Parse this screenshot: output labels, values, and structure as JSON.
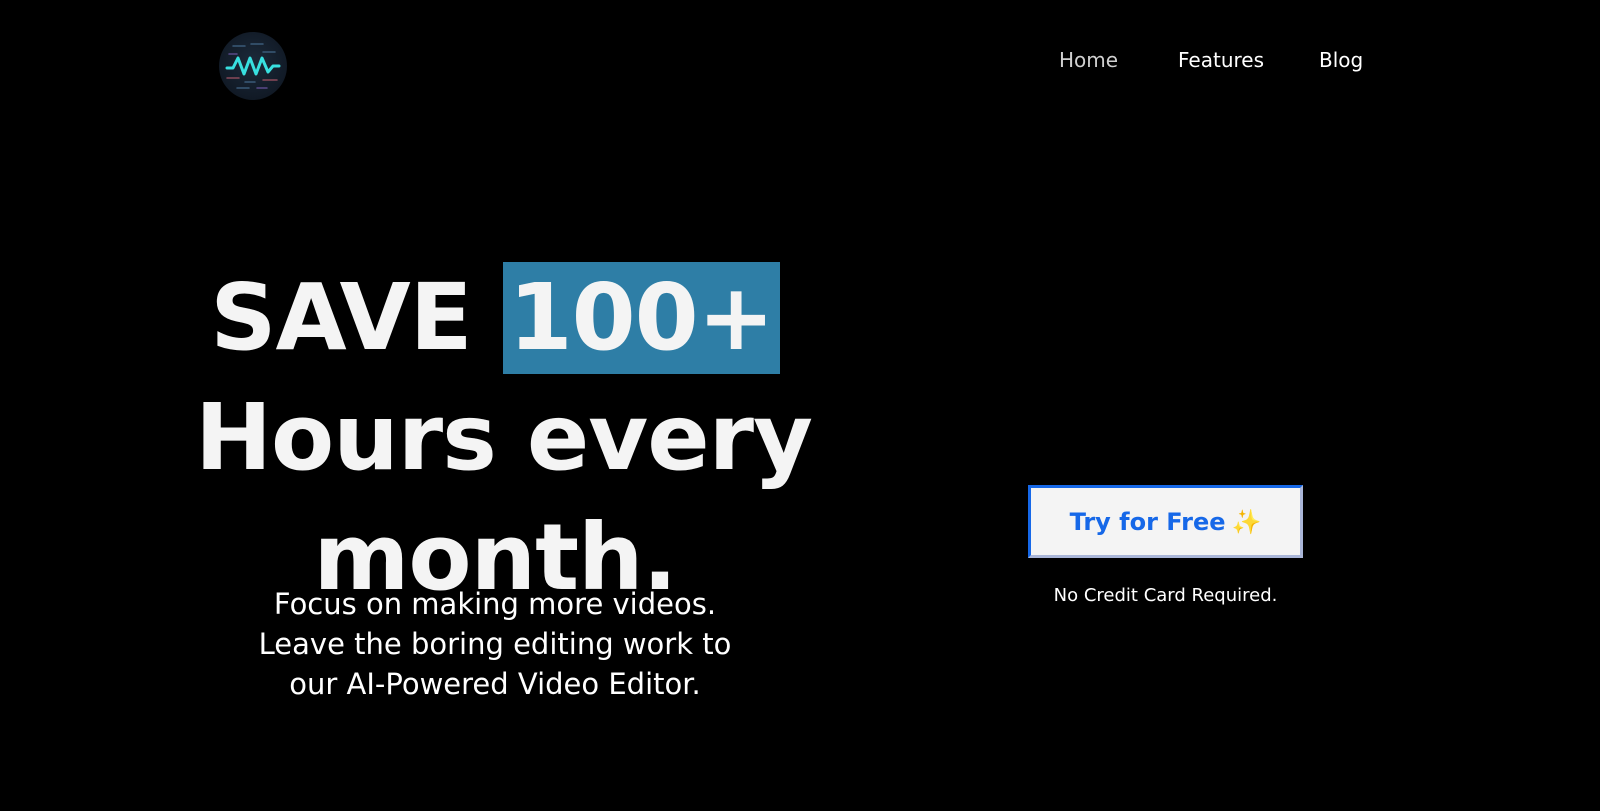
{
  "brand": {
    "logo_icon": "waveform-logo-icon",
    "accent": "#38e0e0"
  },
  "nav": {
    "items": [
      {
        "label": "Home",
        "active": true
      },
      {
        "label": "Features",
        "active": false
      },
      {
        "label": "Blog",
        "active": false
      }
    ]
  },
  "hero": {
    "line1_prefix": "SAVE",
    "line1_highlight": "100+",
    "line2": "Hours every",
    "line3": "month.",
    "highlight_color": "#2e7ea6"
  },
  "subtitle": {
    "lines": [
      "Focus on making more videos.",
      "Leave the boring editing work to",
      "our AI-Powered Video Editor."
    ]
  },
  "cta": {
    "label": "Try for Free",
    "icon": "sparkles-icon",
    "icon_glyph": "✨",
    "color": "#1668e8",
    "note": "No Credit Card Required."
  }
}
